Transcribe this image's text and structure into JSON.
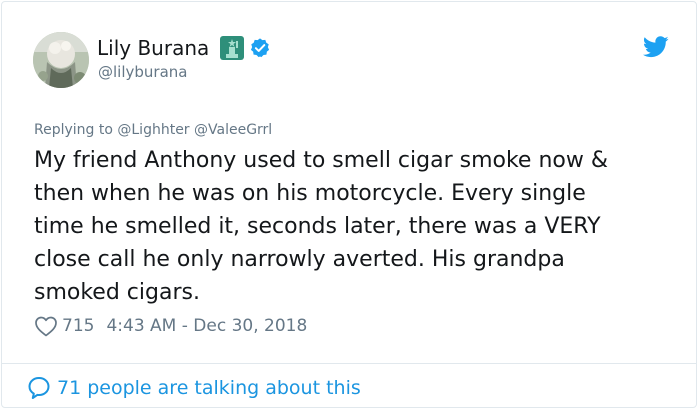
{
  "author": {
    "display_name": "Lily Burana",
    "handle": "@lilyburana",
    "avatar_icon": "avatar-photo",
    "badge_icon": "statue-of-liberty-icon",
    "verified_icon": "verified-badge-icon"
  },
  "brand": {
    "icon": "twitter-bird-icon",
    "color": "#1da1f2"
  },
  "tweet": {
    "reply_to": "Replying to @Lighhter @ValeeGrrl",
    "text": "My friend Anthony used to smell cigar smoke now &\nthen when he was on his motorcycle. Every single\ntime he smelled it, seconds later, there was a VERY\nclose call he only narrowly averted. His grandpa\nsmoked cigars.",
    "likes": "715",
    "timestamp": "4:43 AM - Dec 30, 2018"
  },
  "footer": {
    "talking_text": "71 people are talking about this",
    "icon": "speech-bubble-icon",
    "link_color": "#1b95e0"
  }
}
